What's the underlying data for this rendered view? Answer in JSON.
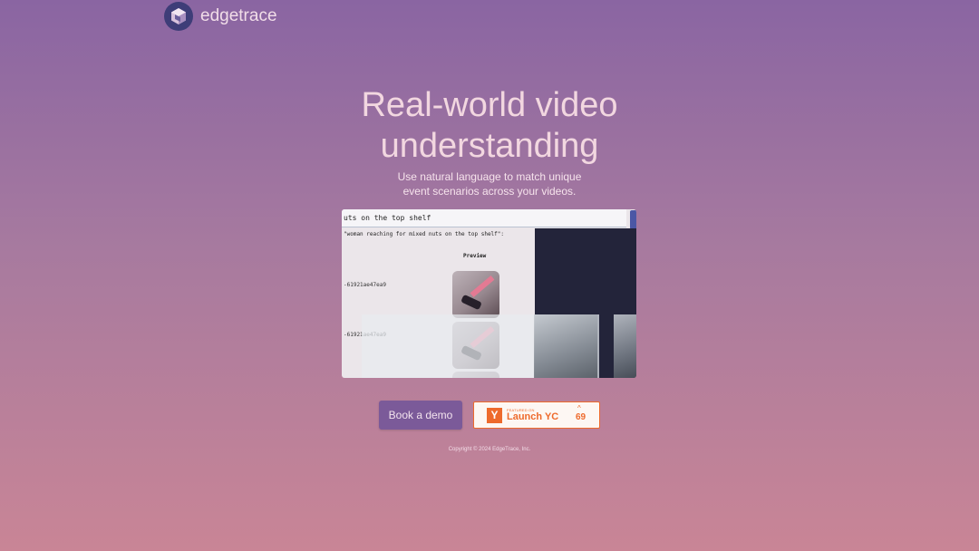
{
  "brand": {
    "name": "edgetrace",
    "logo_icon": "cube-logo-icon"
  },
  "hero": {
    "title_line1": "Real-world video",
    "title_line2": "understanding",
    "subtitle_line1": "Use natural language to match unique",
    "subtitle_line2": "event scenarios across your videos."
  },
  "demo": {
    "search_text": "uts on the top shelf",
    "query_text": "\"woman reaching for mixed nuts on the top shelf\":",
    "preview_header": "Preview",
    "rows": [
      {
        "id": "-61921ae47ea9"
      },
      {
        "id": "-61921ae47ea9"
      }
    ]
  },
  "cta": {
    "book_demo_label": "Book a demo",
    "yc_badge": {
      "logo_letter": "Y",
      "featured_text": "FEATURED ON",
      "launch_text": "Launch YC",
      "upvote_icon": "caret-up-icon",
      "upvote_count": "69"
    }
  },
  "footer": {
    "copyright": "Copyright © 2024 EdgeTrace, Inc."
  },
  "colors": {
    "accent": "#7b5a99",
    "yc_orange": "#ee6a2c",
    "logo_bg": "#3e3d78"
  }
}
